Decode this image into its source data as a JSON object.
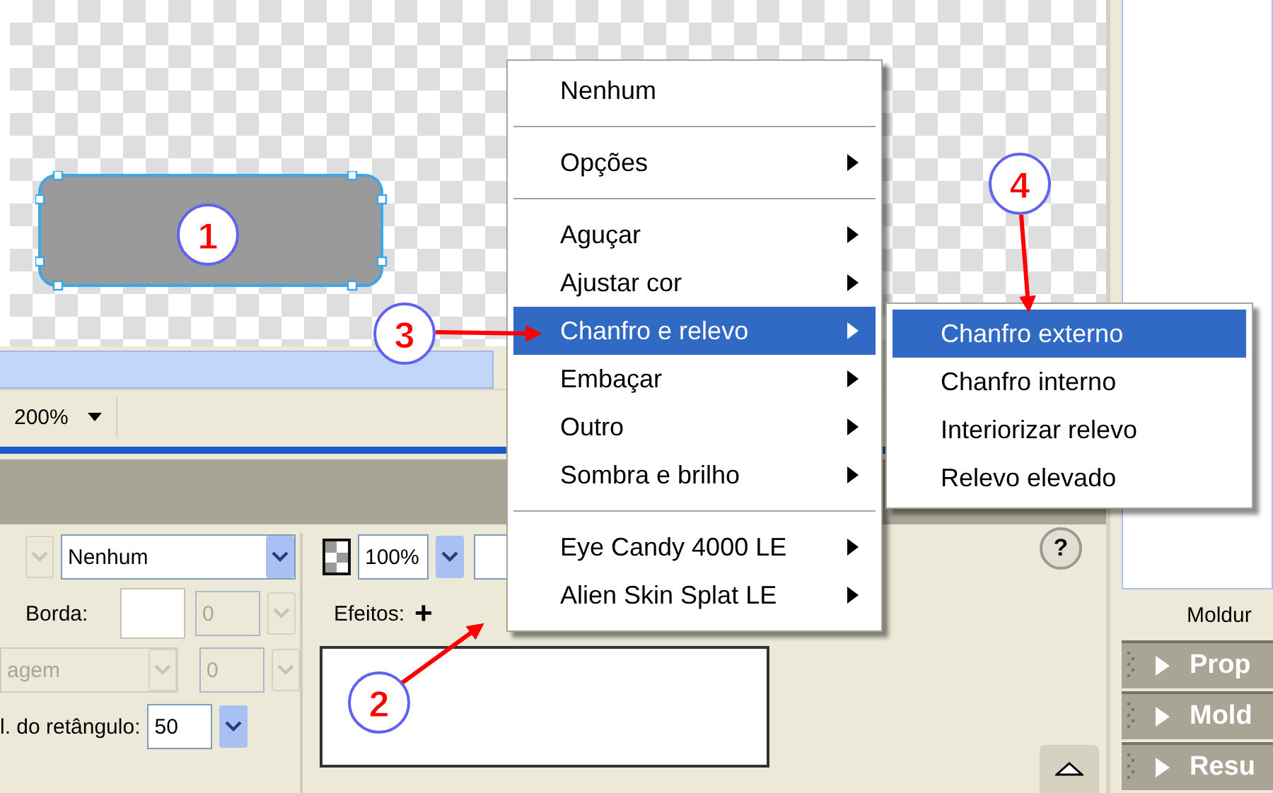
{
  "zoom": {
    "value": "200%"
  },
  "properties": {
    "fill": {
      "value": "Nenhum"
    },
    "border": {
      "label": "Borda:",
      "size": "0",
      "disabled": true
    },
    "texture": {
      "value": "agem",
      "amount": "0",
      "disabled": true
    },
    "roundness": {
      "label": "l. do retângulo:",
      "value": "50"
    },
    "opacity": {
      "value": "100%"
    },
    "effects": {
      "label": "Efeitos:",
      "add": "+"
    },
    "help": "?"
  },
  "context_menu": {
    "items": [
      {
        "kind": "item",
        "label": "Nenhum",
        "submenu": false,
        "selected": false
      },
      {
        "kind": "separator"
      },
      {
        "kind": "item",
        "label": "Opções",
        "submenu": true,
        "selected": false
      },
      {
        "kind": "separator"
      },
      {
        "kind": "item",
        "label": "Aguçar",
        "submenu": true,
        "selected": false
      },
      {
        "kind": "item",
        "label": "Ajustar cor",
        "submenu": true,
        "selected": false
      },
      {
        "kind": "item",
        "label": "Chanfro e relevo",
        "submenu": true,
        "selected": true
      },
      {
        "kind": "item",
        "label": "Embaçar",
        "submenu": true,
        "selected": false
      },
      {
        "kind": "item",
        "label": "Outro",
        "submenu": true,
        "selected": false
      },
      {
        "kind": "item",
        "label": "Sombra e brilho",
        "submenu": true,
        "selected": false
      },
      {
        "kind": "separator"
      },
      {
        "kind": "item",
        "label": "Eye Candy 4000 LE",
        "submenu": true,
        "selected": false
      },
      {
        "kind": "item",
        "label": "Alien Skin Splat LE",
        "submenu": true,
        "selected": false
      }
    ]
  },
  "submenu": {
    "items": [
      {
        "label": "Chanfro externo",
        "selected": true
      },
      {
        "label": "Chanfro interno",
        "selected": false
      },
      {
        "label": "Interiorizar relevo",
        "selected": false
      },
      {
        "label": "Relevo elevado",
        "selected": false
      }
    ]
  },
  "side_panel": {
    "label": "Moldur",
    "panels": [
      {
        "title": "Prop",
        "expanded": false
      },
      {
        "title": "Mold",
        "expanded": false
      },
      {
        "title": "Resu",
        "expanded": false
      }
    ]
  },
  "callouts": [
    {
      "label": "1"
    },
    {
      "label": "2"
    },
    {
      "label": "3"
    },
    {
      "label": "4"
    }
  ]
}
